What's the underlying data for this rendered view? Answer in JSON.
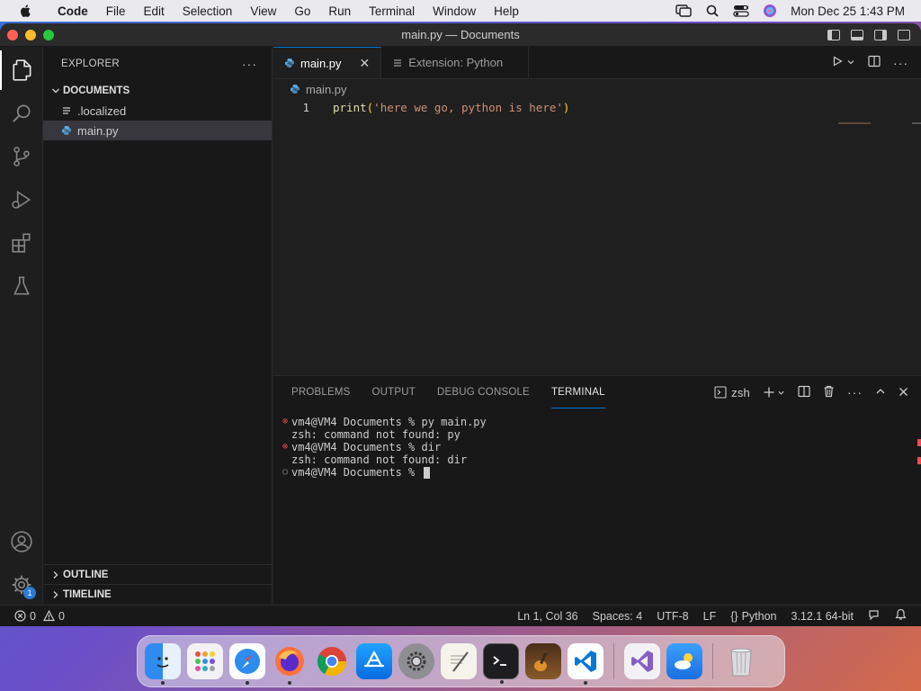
{
  "menubar": {
    "app": "Code",
    "items": [
      "File",
      "Edit",
      "Selection",
      "View",
      "Go",
      "Run",
      "Terminal",
      "Window",
      "Help"
    ],
    "clock": "Mon Dec 25  1:43 PM"
  },
  "window": {
    "title": "main.py — Documents"
  },
  "explorer": {
    "title": "EXPLORER",
    "more": "···",
    "folder": "DOCUMENTS",
    "files": [
      ".localized",
      "main.py"
    ],
    "outline": "OUTLINE",
    "timeline": "TIMELINE"
  },
  "activity": {
    "accounts_badge": "1"
  },
  "editor": {
    "tabs": [
      {
        "label": "main.py",
        "active": true,
        "close": "✕"
      },
      {
        "label": "Extension: Python",
        "active": false
      }
    ],
    "breadcrumb": "main.py",
    "lines": [
      {
        "num": "1",
        "fn": "print",
        "open": "(",
        "str": "'here we go, python is here'",
        "close": ")"
      }
    ]
  },
  "panel": {
    "tabs": [
      "PROBLEMS",
      "OUTPUT",
      "DEBUG CONSOLE",
      "TERMINAL"
    ],
    "active_tab": "TERMINAL",
    "shell": "zsh",
    "lines": [
      {
        "marker": "error",
        "text": "vm4@VM4 Documents % py main.py"
      },
      {
        "marker": "none",
        "text": "zsh: command not found: py"
      },
      {
        "marker": "error",
        "text": "vm4@VM4 Documents % dir"
      },
      {
        "marker": "none",
        "text": "zsh: command not found: dir"
      },
      {
        "marker": "ok",
        "text": "vm4@VM4 Documents % "
      }
    ]
  },
  "status": {
    "errors": "0",
    "warnings": "0",
    "position": "Ln 1, Col 36",
    "spaces": "Spaces: 4",
    "encoding": "UTF-8",
    "eol": "LF",
    "language": "Python",
    "interpreter": "3.12.1 64-bit"
  },
  "colors": {
    "accent": "#0078d4",
    "error": "#f14c4c",
    "string": "#ce9178",
    "function": "#dcdcaa"
  }
}
